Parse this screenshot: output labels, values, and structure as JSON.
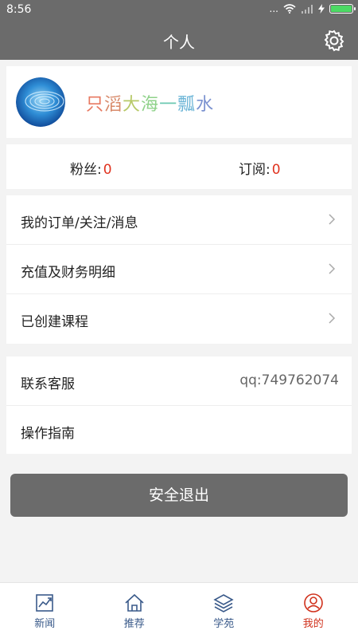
{
  "status_bar": {
    "time": "8:56",
    "signal_text": "...",
    "battery_level": 1.0
  },
  "header": {
    "title": "个人"
  },
  "profile": {
    "name_chars": [
      "只",
      "滔",
      "大",
      "海",
      "一",
      "瓢",
      "水"
    ]
  },
  "stats": {
    "fans_label": "粉丝:",
    "fans_value": "0",
    "subs_label": "订阅:",
    "subs_value": "0"
  },
  "menu": [
    {
      "label": "我的订单/关注/消息"
    },
    {
      "label": "充值及财务明细"
    },
    {
      "label": "已创建课程"
    }
  ],
  "info": [
    {
      "label": "联系客服",
      "value": "qq:749762074"
    },
    {
      "label": "操作指南",
      "value": ""
    }
  ],
  "logout_label": "安全退出",
  "tabs": [
    {
      "label": "新闻",
      "icon": "chart-icon"
    },
    {
      "label": "推荐",
      "icon": "home-icon"
    },
    {
      "label": "学苑",
      "icon": "layers-icon"
    },
    {
      "label": "我的",
      "icon": "user-icon"
    }
  ],
  "colors": {
    "header_bg": "#6b6b6b",
    "accent_red": "#d0311c",
    "tab_blue": "#3a5a8a"
  }
}
